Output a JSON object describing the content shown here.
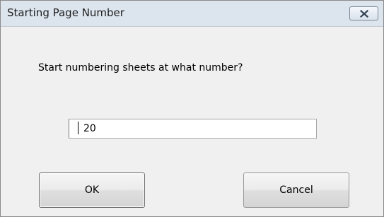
{
  "dialog": {
    "title": "Starting Page Number",
    "prompt": "Start numbering sheets at what number?",
    "input_value": "20",
    "ok_label": "OK",
    "cancel_label": "Cancel",
    "close_icon": "close-icon"
  }
}
